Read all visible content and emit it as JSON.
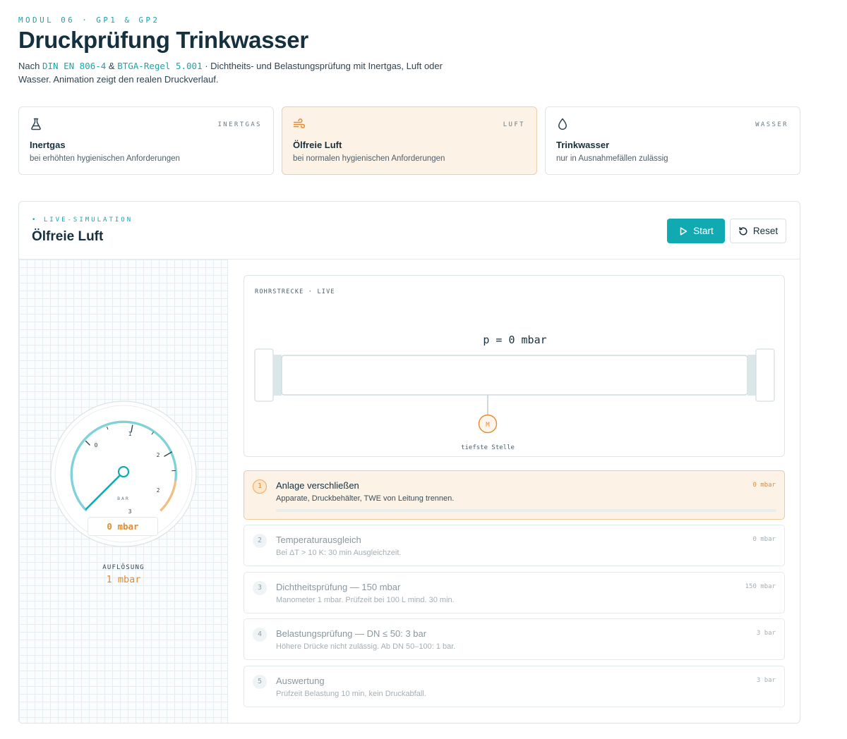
{
  "header": {
    "eyebrow": "MODUL 06 · GP1 & GP2",
    "title": "Druckprüfung Trinkwasser",
    "subtitle_prefix": "Nach ",
    "norm1": "DIN EN 806-4",
    "amp": " & ",
    "norm2": "BTGA-Regel 5.001",
    "subtitle_suffix": " · Dichtheits- und Belastungsprüfung mit Inertgas, Luft oder Wasser. Animation zeigt den realen Druckverlauf."
  },
  "media": [
    {
      "tag": "INERTGAS",
      "name": "Inertgas",
      "desc": "bei erhöhten hygienischen Anforderungen",
      "icon": "flask-icon",
      "active": false
    },
    {
      "tag": "LUFT",
      "name": "Ölfreie Luft",
      "desc": "bei normalen hygienischen Anforderungen",
      "icon": "wind-icon",
      "active": true
    },
    {
      "tag": "WASSER",
      "name": "Trinkwasser",
      "desc": "nur in Ausnahmefällen zulässig",
      "icon": "droplet-icon",
      "active": false
    }
  ],
  "simulation": {
    "live_tag": "• LIVE-SIMULATION",
    "title": "Ölfreie Luft",
    "start_label": "Start",
    "reset_label": "Reset"
  },
  "gauge": {
    "unit": "BAR",
    "ticks": [
      "0",
      "1",
      "2",
      "2",
      "3"
    ],
    "needle_value_mbar": 0,
    "readout": "0 mbar",
    "resolution_label": "AUFLÖSUNG",
    "resolution_value": "1 mbar",
    "accent": "#7fd3d8",
    "warn": "#f0c083"
  },
  "pipe": {
    "tag": "ROHRSTRECKE · LIVE",
    "pressure": "p = 0 mbar",
    "manometer_label": "M",
    "low_point_label": "tiefste Stelle"
  },
  "steps": [
    {
      "num": "1",
      "name": "Anlage verschließen",
      "desc": "Apparate, Druckbehälter, TWE von Leitung trennen.",
      "value": "0 mbar",
      "active": true,
      "progress": 0
    },
    {
      "num": "2",
      "name": "Temperaturausgleich",
      "desc": "Bei ΔT > 10 K: 30 min Ausgleichzeit.",
      "value": "0 mbar",
      "active": false
    },
    {
      "num": "3",
      "name": "Dichtheitsprüfung — 150 mbar",
      "desc": "Manometer 1 mbar. Prüfzeit bei 100 L mind. 30 min.",
      "value": "150 mbar",
      "active": false
    },
    {
      "num": "4",
      "name": "Belastungsprüfung — DN ≤ 50: 3 bar",
      "desc": "Höhere Drücke nicht zulässig. Ab DN 50–100: 1 bar.",
      "value": "3 bar",
      "active": false
    },
    {
      "num": "5",
      "name": "Auswertung",
      "desc": "Prüfzeit Belastung 10 min, kein Druckabfall.",
      "value": "3 bar",
      "active": false
    }
  ],
  "colors": {
    "accent": "#12aab2",
    "warning": "#e38b2e",
    "title": "#15303e"
  }
}
